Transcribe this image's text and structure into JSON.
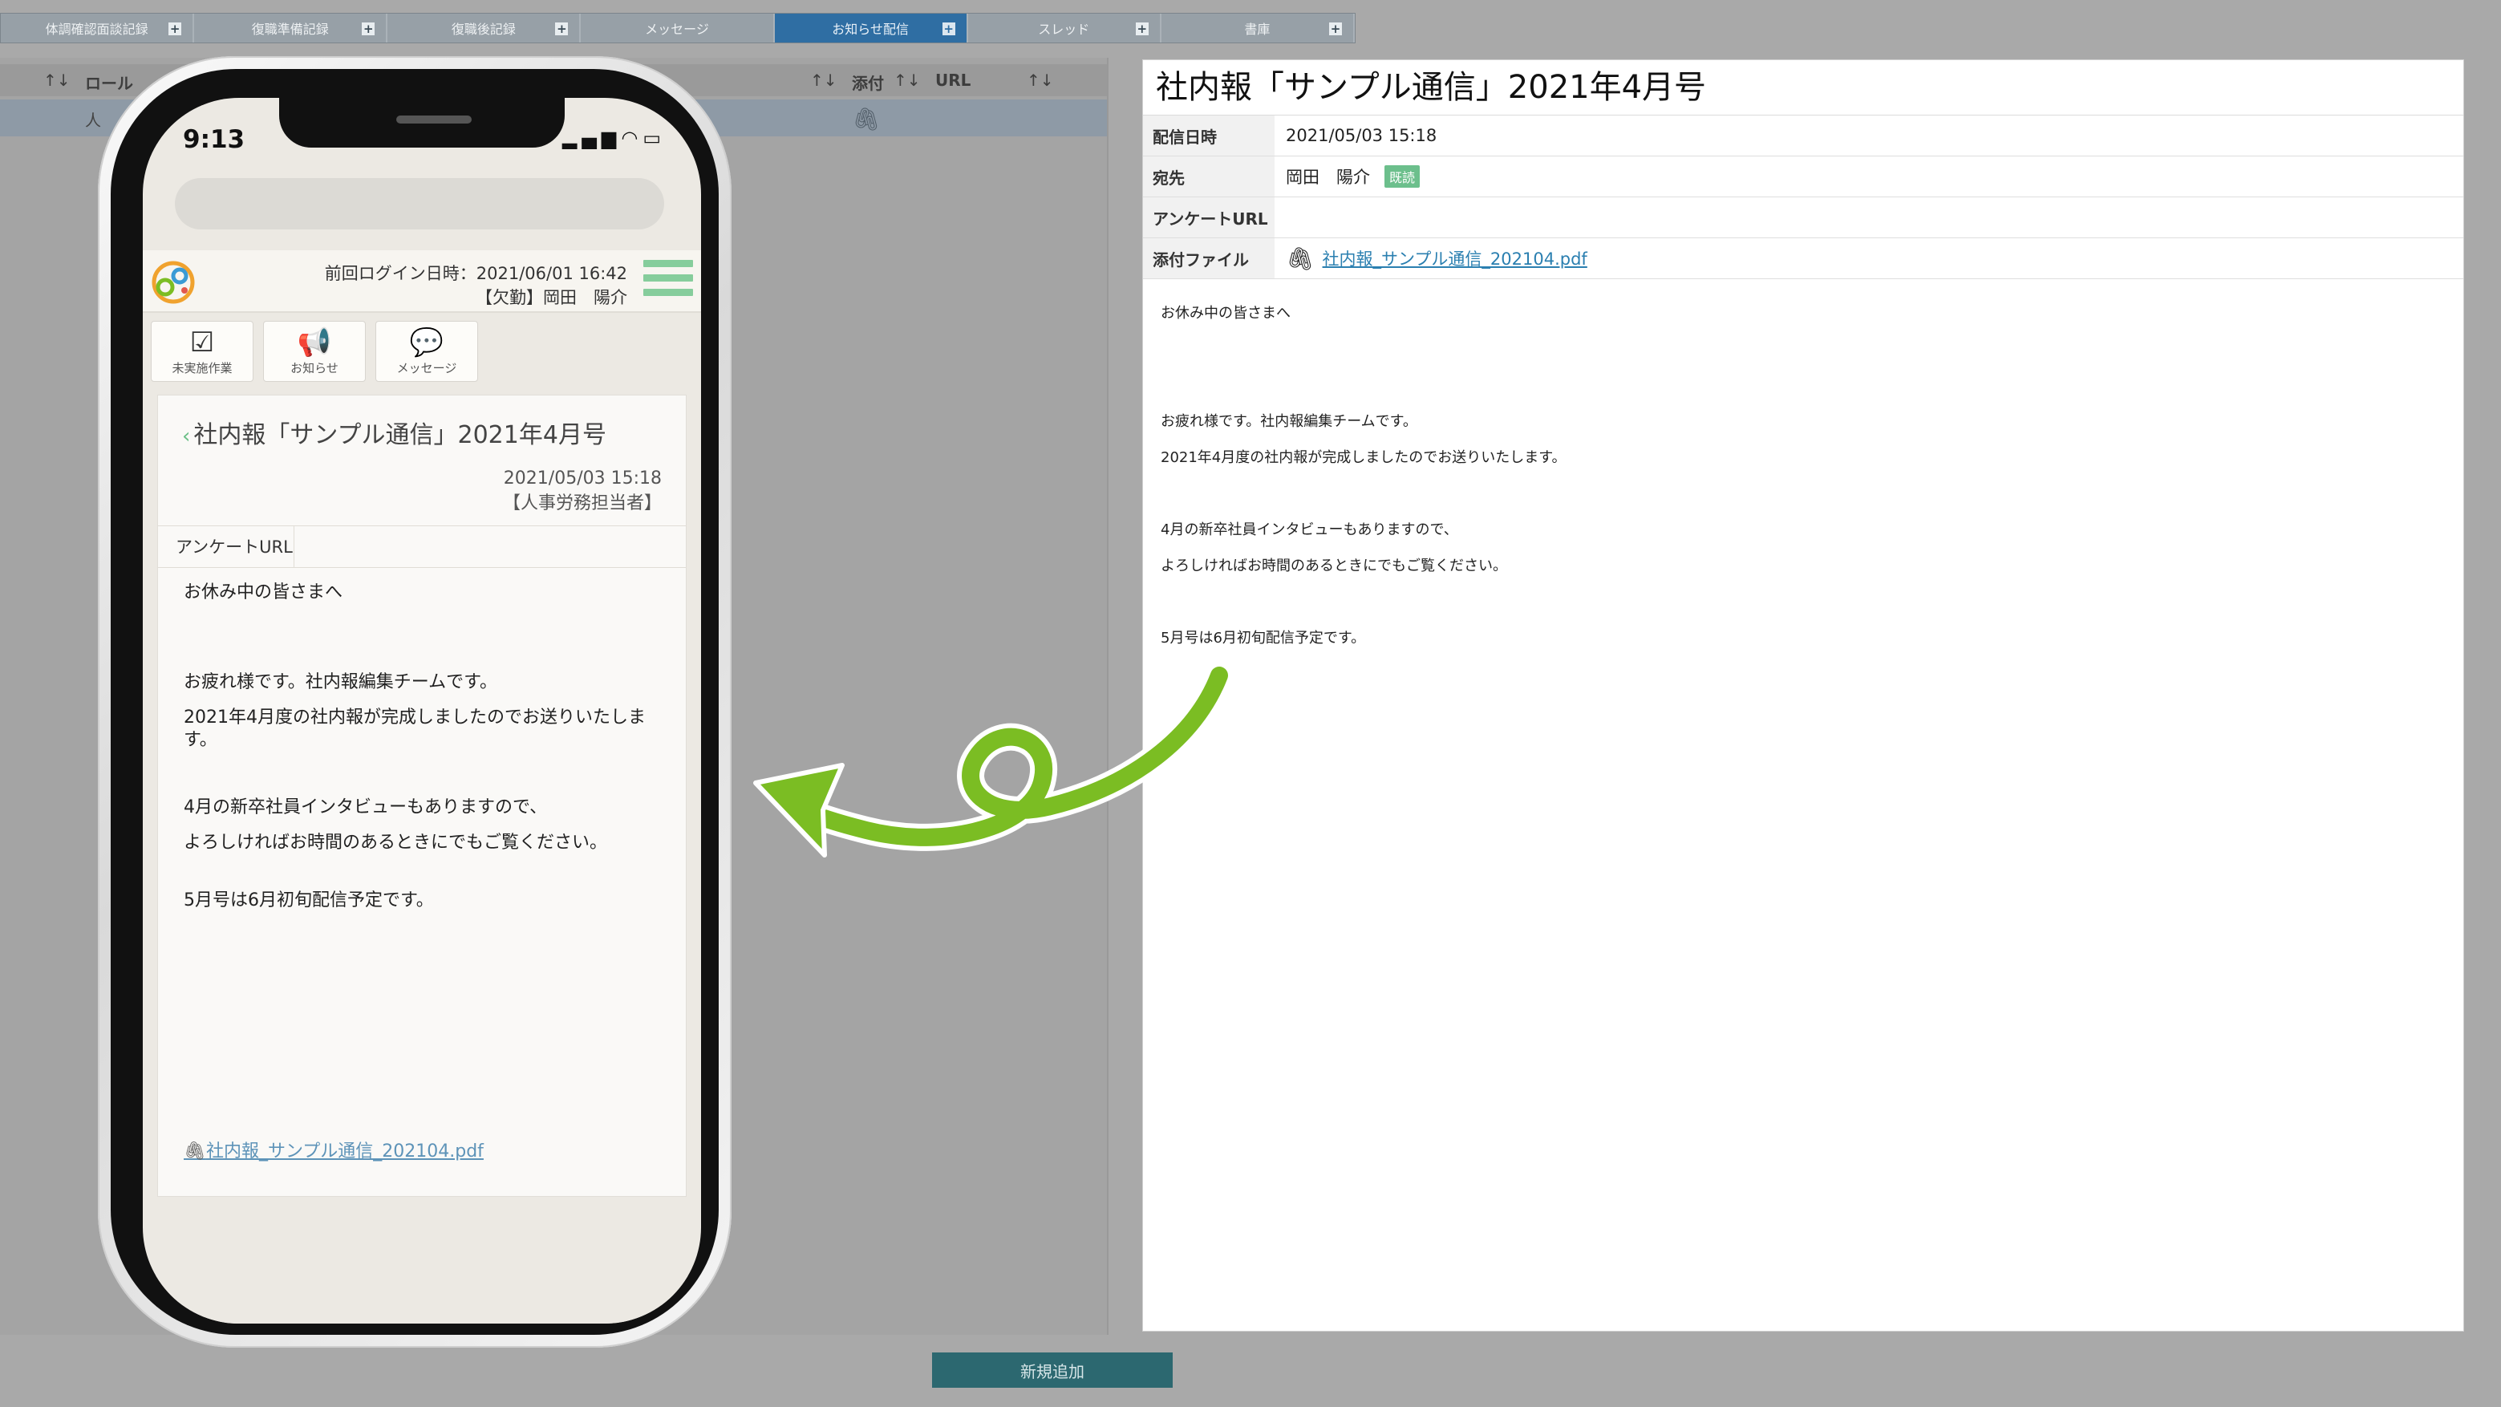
{
  "tabs": [
    {
      "label": "体調確認面談記録",
      "active": false
    },
    {
      "label": "復職準備記録",
      "active": false
    },
    {
      "label": "復職後記録",
      "active": false
    },
    {
      "label": "メッセージ",
      "active": false
    },
    {
      "label": "お知らせ配信",
      "active": true
    },
    {
      "label": "スレッド",
      "active": false
    },
    {
      "label": "書庫",
      "active": false
    }
  ],
  "list": {
    "header": {
      "role": "ロール",
      "attachment": "添付",
      "url": "URL"
    },
    "row": {
      "role_partial": "人"
    }
  },
  "bottom": {
    "add_button": "新規追加"
  },
  "detail": {
    "title": "社内報「サンプル通信」2021年4月号",
    "rows": {
      "date_label": "配信日時",
      "date_value": "2021/05/03 15:18",
      "to_label": "宛先",
      "to_value": "岡田　陽介",
      "to_badge": "既読",
      "survey_label": "アンケートURL",
      "survey_value": "",
      "file_label": "添付ファイル",
      "file_value": "社内報_サンプル通信_202104.pdf"
    },
    "body": [
      "お休み中の皆さまへ",
      "",
      "",
      "お疲れ様です。社内報編集チームです。",
      "2021年4月度の社内報が完成しましたのでお送りいたします。",
      "",
      "4月の新卒社員インタビューもありますので、",
      "よろしければお時間のあるときにでもご覧ください。",
      "",
      "5月号は6月初旬配信予定です。"
    ]
  },
  "phone": {
    "time": "9:13",
    "login": {
      "line1": "前回ログイン日時：2021/06/01 16:42",
      "line2": "【欠勤】岡田　陽介"
    },
    "nav": [
      {
        "label": "未実施作業",
        "icon": "check-icon"
      },
      {
        "label": "お知らせ",
        "icon": "megaphone-icon"
      },
      {
        "label": "メッセージ",
        "icon": "chat-icon"
      }
    ],
    "card": {
      "title": "社内報「サンプル通信」2021年4月号",
      "date": "2021/05/03 15:18",
      "author": "【人事労務担当者】",
      "tab": "アンケートURL",
      "body": {
        "greeting": "お休み中の皆さまへ",
        "p1": "お疲れ様です。社内報編集チームです。",
        "p2": "2021年4月度の社内報が完成しましたのでお送りいたします。",
        "p3": "4月の新卒社員インタビューもありますので、",
        "p4": "よろしければお時間のあるときにでもご覧ください。",
        "p5": "5月号は6月初旬配信予定です。"
      },
      "attachment": "社内報_サンプル通信_202104.pdf"
    }
  },
  "colors": {
    "accent_green": "#7bbd23",
    "tab_active": "#2f6ea3",
    "badge": "#6cbf8c",
    "hamburger": "#86cd9c"
  }
}
